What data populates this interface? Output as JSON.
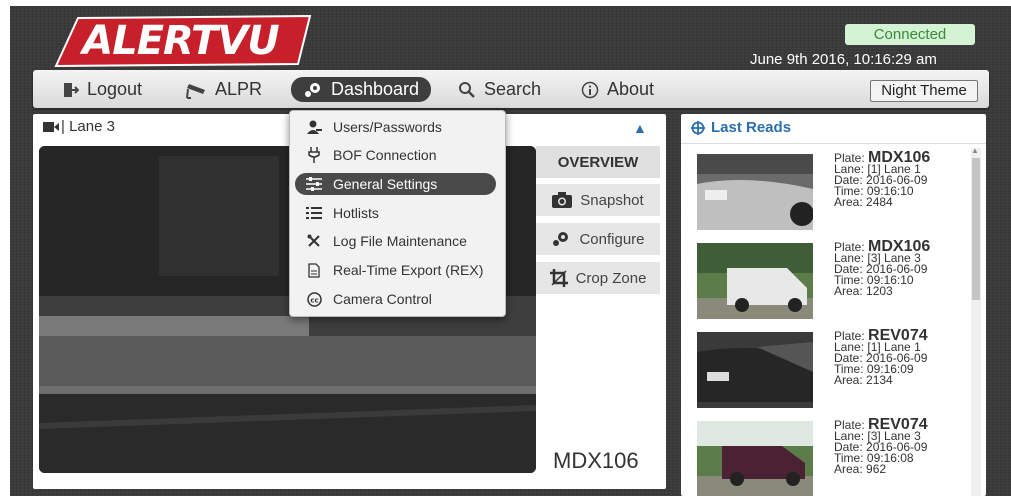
{
  "app": {
    "logo_text": "ALERTVU",
    "status": "Connected",
    "datetime": "June 9th 2016, 10:16:29 am"
  },
  "nav": {
    "logout": "Logout",
    "alpr": "ALPR",
    "dashboard": "Dashboard",
    "search": "Search",
    "about": "About",
    "night_theme": "Night Theme"
  },
  "lane": {
    "title": "| Lane 3",
    "buttons": {
      "overview": "OVERVIEW",
      "snapshot": "Snapshot",
      "configure": "Configure",
      "crop_zone": "Crop Zone"
    },
    "plate_read": "MDX106"
  },
  "dropdown": {
    "items": [
      {
        "label": "Users/Passwords",
        "icon": "users-icon"
      },
      {
        "label": "BOF Connection",
        "icon": "plug-icon"
      },
      {
        "label": "General Settings",
        "icon": "sliders-icon"
      },
      {
        "label": "Hotlists",
        "icon": "list-icon"
      },
      {
        "label": "Log File Maintenance",
        "icon": "wrench-icon"
      },
      {
        "label": "Real-Time Export (REX)",
        "icon": "file-icon"
      },
      {
        "label": "Camera Control",
        "icon": "cc-icon"
      }
    ]
  },
  "last_reads": {
    "title": "Last Reads",
    "items": [
      {
        "plate_label": "Plate:",
        "plate": "MDX106",
        "lane": "Lane: [1] Lane 1",
        "date": "Date: 2016-06-09",
        "time": "Time: 09:16:10",
        "area": "Area: 2484"
      },
      {
        "plate_label": "Plate:",
        "plate": "MDX106",
        "lane": "Lane: [3] Lane 3",
        "date": "Date: 2016-06-09",
        "time": "Time: 09:16:10",
        "area": "Area: 1203"
      },
      {
        "plate_label": "Plate:",
        "plate": "REV074",
        "lane": "Lane: [1] Lane 1",
        "date": "Date: 2016-06-09",
        "time": "Time: 09:16:09",
        "area": "Area: 2134"
      },
      {
        "plate_label": "Plate:",
        "plate": "REV074",
        "lane": "Lane: [3] Lane 3",
        "date": "Date: 2016-06-09",
        "time": "Time: 09:16:08",
        "area": "Area: 962"
      }
    ]
  },
  "colors": {
    "accent": "#2b6fb0",
    "logo_red": "#c8202a",
    "status_green": "#3a8a3a"
  }
}
